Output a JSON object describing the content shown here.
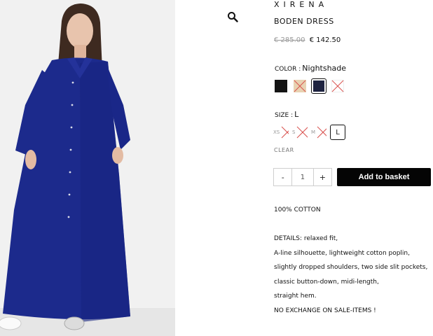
{
  "product": {
    "brand": "XIRENA",
    "title": "BODEN DRESS",
    "price_old": "€ 285.00",
    "price_new": "€ 142.50"
  },
  "color": {
    "label": "COLOR :",
    "selected": "Nightshade",
    "swatches": [
      {
        "name": "black",
        "color": "#141414",
        "unavailable": false,
        "selected": false
      },
      {
        "name": "camel",
        "color": "#e8d2b2",
        "unavailable": true,
        "selected": false
      },
      {
        "name": "nightshade",
        "color": "#1e2340",
        "unavailable": false,
        "selected": true
      },
      {
        "name": "white",
        "color": "#ffffff",
        "unavailable": true,
        "selected": false
      }
    ]
  },
  "size": {
    "label": "SIZE :",
    "selected": "L",
    "options": [
      {
        "label": "XS",
        "unavailable": true
      },
      {
        "label": "S",
        "unavailable": true
      },
      {
        "label": "M",
        "unavailable": true
      },
      {
        "label": "L",
        "unavailable": false,
        "selected": true
      }
    ],
    "clear_label": "CLEAR"
  },
  "cart": {
    "minus": "-",
    "quantity": "1",
    "plus": "+",
    "add_label": "Add to basket"
  },
  "description": {
    "material": "100% COTTON",
    "lines": [
      "DETAILS: relaxed fit,",
      "A-line silhouette, lightweight cotton poplin,",
      "slightly dropped shoulders, two side slit pockets,",
      "classic button-down, midi-length,",
      "straight hem.",
      "NO EXCHANGE ON SALE-ITEMS  !"
    ]
  },
  "icons": {
    "zoom": "magnifier-icon",
    "unavailable": "cross-out-icon"
  }
}
